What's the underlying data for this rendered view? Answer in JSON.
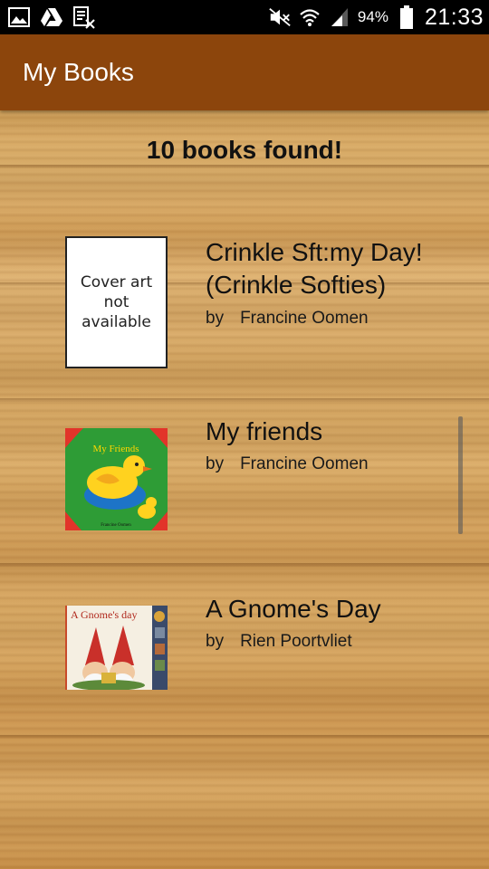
{
  "status_bar": {
    "left_icons": [
      "gallery-icon",
      "drive-icon",
      "reader-icon"
    ],
    "right_icons": [
      "mute-icon",
      "wifi-icon",
      "signal-icon",
      "battery-icon"
    ],
    "battery_percent": "94%",
    "time": "21:33"
  },
  "app_bar": {
    "title": "My Books"
  },
  "results": {
    "count_text": "10 books found!"
  },
  "books": [
    {
      "title": "Crinkle Sft:my Day! (Crinkle Softies)",
      "by": "by",
      "author": "Francine Oomen",
      "cover_placeholder": "Cover art not available"
    },
    {
      "title": "My friends",
      "by": "by",
      "author": "Francine Oomen",
      "cover_text": "My Friends",
      "cover_subtext": "Francine Oomen"
    },
    {
      "title": "A Gnome's Day",
      "by": "by",
      "author": "Rien Poortvliet",
      "cover_text": "A Gnome's day"
    }
  ],
  "colors": {
    "app_bar": "#8c450c",
    "status_bar": "#000000",
    "wood_base": "#d4a55e"
  }
}
